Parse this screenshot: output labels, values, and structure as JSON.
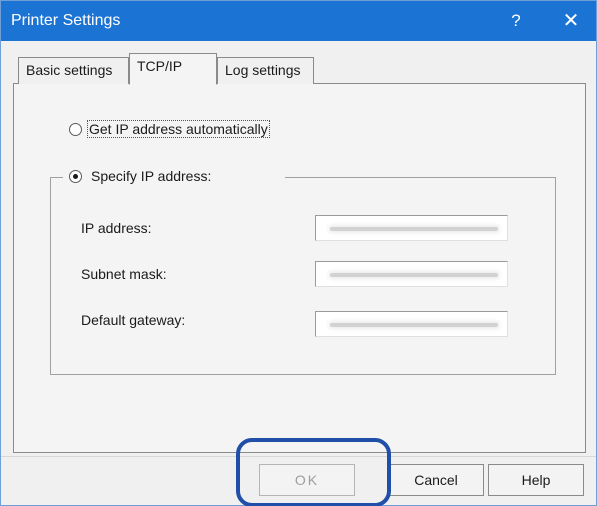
{
  "window": {
    "title": "Printer Settings",
    "help_glyph": "?",
    "close_glyph": "✕"
  },
  "tabs": [
    {
      "label": "Basic settings",
      "active": false
    },
    {
      "label": "TCP/IP",
      "active": true
    },
    {
      "label": "Log settings",
      "active": false
    }
  ],
  "ip_mode": {
    "auto_label": "Get IP address automatically",
    "auto_selected": false,
    "specify_label": "Specify IP address:",
    "specify_selected": true
  },
  "fields": {
    "ip_address": {
      "label": "IP address:",
      "value": ""
    },
    "subnet_mask": {
      "label": "Subnet mask:",
      "value": ""
    },
    "default_gateway": {
      "label": "Default gateway:",
      "value": ""
    }
  },
  "buttons": {
    "ok": {
      "label": "OK",
      "enabled": false
    },
    "cancel": {
      "label": "Cancel"
    },
    "help": {
      "label": "Help"
    }
  },
  "colors": {
    "titlebar": "#1b74d3",
    "highlight_ring": "#1f4fa8"
  }
}
